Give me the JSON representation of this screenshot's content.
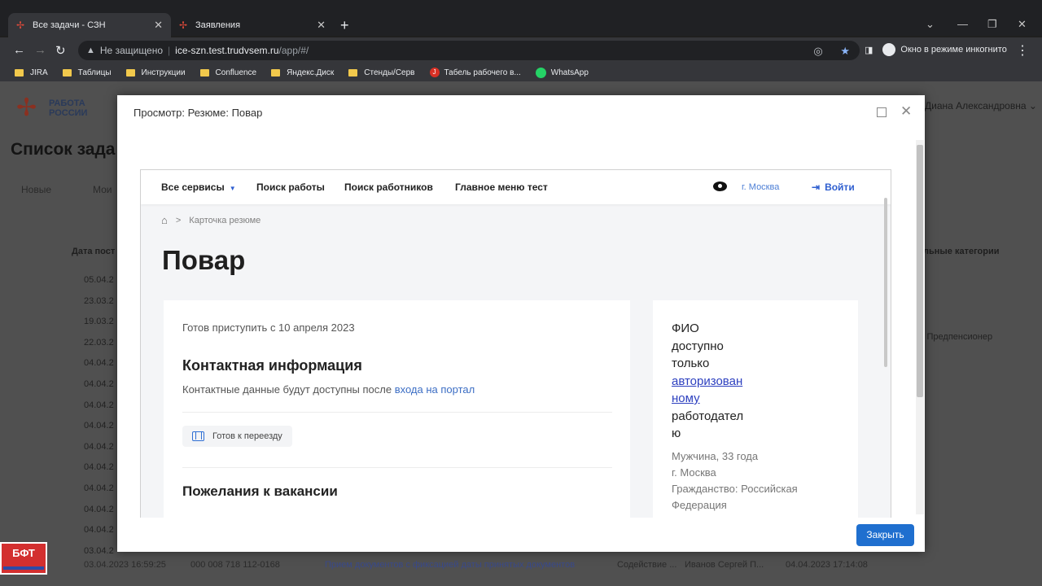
{
  "browser": {
    "tabs": [
      {
        "label": "Все задачи - СЗН"
      },
      {
        "label": "Заявления"
      }
    ],
    "new_tab": "+",
    "url_warning": "Не защищено",
    "url_host": "ice-szn.test.trudvsem.ru",
    "url_path": "/app/#/",
    "profile": "Окно в режиме инкогнито",
    "bookmarks": [
      {
        "label": "JIRA"
      },
      {
        "label": "Таблицы"
      },
      {
        "label": "Инструкции"
      },
      {
        "label": "Confluence"
      },
      {
        "label": "Яндекс.Диск"
      },
      {
        "label": "Стенды/Серв"
      },
      {
        "label": "Табель рабочего в..."
      },
      {
        "label": "WhatsApp"
      }
    ]
  },
  "app": {
    "logo_line1": "РАБОТА",
    "logo_line2": "РОССИИ",
    "page_title": "Список зада",
    "user_name": "Диана Александровна",
    "tabs": {
      "new": "Новые",
      "mine": "Мои"
    },
    "col_date": "Дата пост",
    "col_categories": "льные категории",
    "dates": [
      "05.04.2",
      "23.03.2",
      "19.03.2",
      "22.03.2",
      "04.04.2",
      "04.04.2",
      "04.04.2",
      "04.04.2",
      "04.04.2",
      "04.04.2",
      "04.04.2",
      "04.04.2",
      "04.04.2",
      "03.04.2"
    ],
    "category_value": "д, Предпенсионер",
    "last_row": {
      "date": "03.04.2023 16:59:25",
      "snils": "000 008 718 112-0168",
      "service": "Прием документов с фиксацией даты принятых документов",
      "type": "Содействие ...",
      "person": "Иванов Сергей П...",
      "updated": "04.04.2023 17:14:08"
    },
    "badge": "БФТ"
  },
  "modal": {
    "title": "Просмотр: Резюме: Повар",
    "close_button": "Закрыть"
  },
  "portal": {
    "nav": {
      "all_services": "Все сервисы",
      "job_search": "Поиск работы",
      "worker_search": "Поиск работников",
      "main_menu": "Главное меню тест",
      "city": "г. Москва",
      "login": "Войти"
    },
    "breadcrumb": "Карточка резюме",
    "title": "Повар",
    "ready_from": "Готов приступить с 10 апреля 2023",
    "contact_heading": "Контактная информация",
    "contact_note_before": "Контактные данные будут доступны после ",
    "contact_note_link": "входа на портал",
    "relocation": "Готов к переезду",
    "wishes_heading": "Пожелания к вакансии",
    "side": {
      "fio_text": [
        "ФИО",
        "доступно",
        "только"
      ],
      "fio_link": [
        "авторизован",
        "ному"
      ],
      "fio_tail": [
        "работодател",
        "ю"
      ],
      "gender_age": "Мужчина, 33 года",
      "city": "г. Москва",
      "citizenship": "Гражданство: Российская Федерация"
    }
  }
}
